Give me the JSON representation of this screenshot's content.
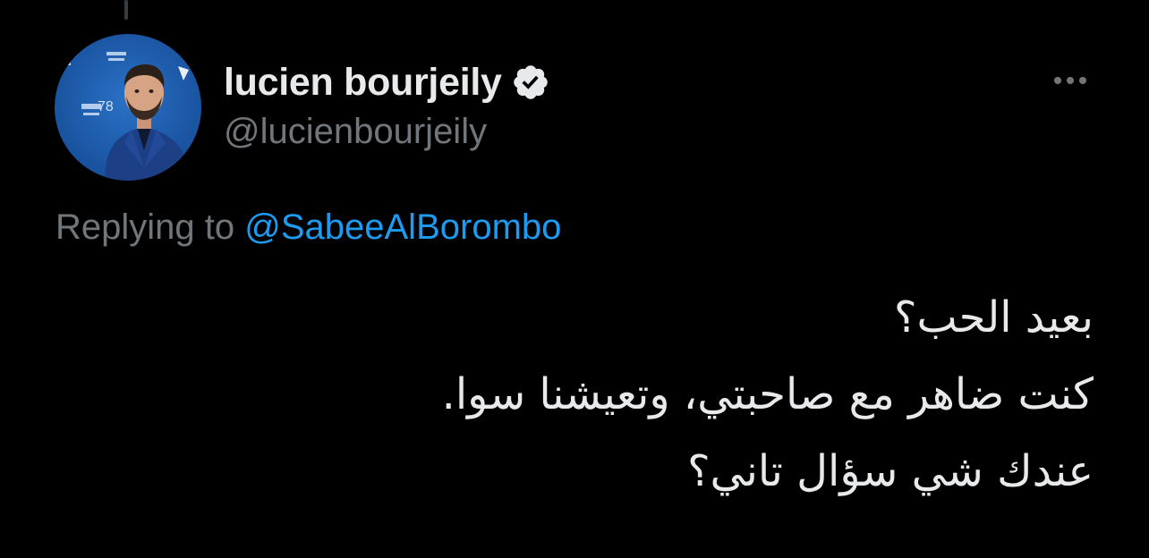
{
  "author": {
    "display_name": "lucien bourjeily",
    "handle": "@lucienbourjeily",
    "verified": true,
    "avatar": {
      "backdrop_color": "#1f5fb3",
      "backdrop_text": "78"
    }
  },
  "reply": {
    "prefix": "Replying to",
    "mention": "@SabeeAlBorombo"
  },
  "tweet": {
    "lines": [
      "بعيد الحب؟",
      "كنت ضاهر مع صاحبتي، وتعيشنا سوا.",
      "عندك شي سؤال تاني؟"
    ]
  },
  "colors": {
    "background": "#000000",
    "primary_text": "#e7e9ea",
    "secondary_text": "#71767b",
    "accent": "#1d9bf0"
  },
  "icons": {
    "verified": "verified-badge-icon",
    "more": "more-horizontal-icon"
  }
}
